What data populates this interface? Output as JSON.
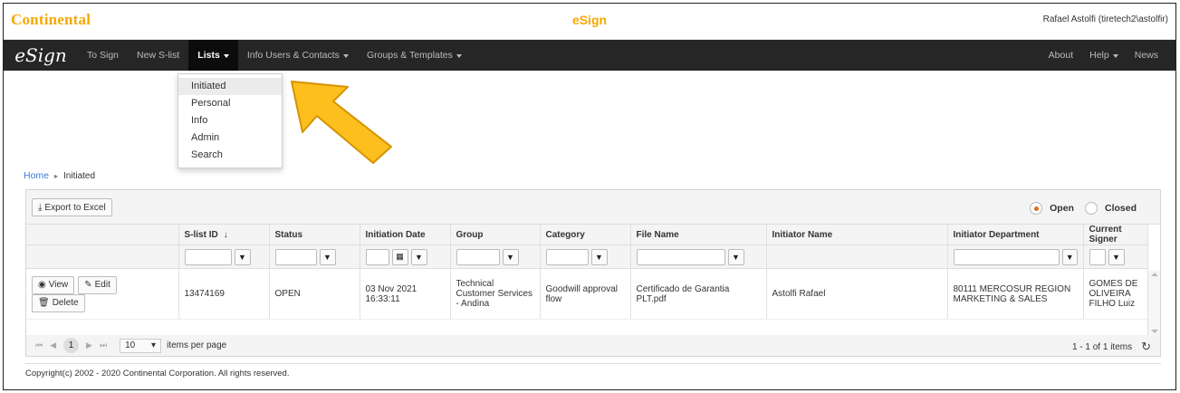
{
  "header": {
    "logo": "Continental",
    "app_title": "eSign",
    "user": "Rafael Astolfi (tiretech2\\astolfir)"
  },
  "nav": {
    "brand": "eSign",
    "items": [
      "To Sign",
      "New S-list",
      "Lists",
      "Info Users & Contacts",
      "Groups & Templates"
    ],
    "right": [
      "About",
      "Help",
      "News"
    ]
  },
  "dropdown": {
    "items": [
      "Initiated",
      "Personal",
      "Info",
      "Admin",
      "Search"
    ]
  },
  "breadcrumb": {
    "home": "Home",
    "current": "Initiated"
  },
  "toolbar": {
    "export": "Export to Excel",
    "open": "Open",
    "closed": "Closed"
  },
  "grid": {
    "columns": [
      "S-list ID",
      "Status",
      "Initiation Date",
      "Group",
      "Category",
      "File Name",
      "Initiator Name",
      "Initiator Department",
      "Current Signer"
    ],
    "row_actions": [
      "View",
      "Edit",
      "Delete"
    ],
    "rows": [
      {
        "slist_id": "13474169",
        "status": "OPEN",
        "initiation_date": "03 Nov 2021 16:33:11",
        "group": "Technical Customer Services - Andina",
        "category": "Goodwill approval flow",
        "file_name": "Certificado de Garantia PLT.pdf",
        "initiator_name": "Astolfi Rafael",
        "initiator_department": "80111 MERCOSUR REGION MARKETING & SALES",
        "current_signer": "GOMES DE OLIVEIRA FILHO Luiz"
      }
    ]
  },
  "pager": {
    "current_page": "1",
    "page_size": "10",
    "page_size_label": "items per page",
    "info": "1 - 1 of 1 items"
  },
  "footer": "Copyright(c) 2002 - 2020 Continental Corporation. All rights reserved.",
  "colors": {
    "accent": "#f6a800",
    "navbar": "#262626",
    "link": "#3a7bd5",
    "radio": "#e06a1b"
  }
}
